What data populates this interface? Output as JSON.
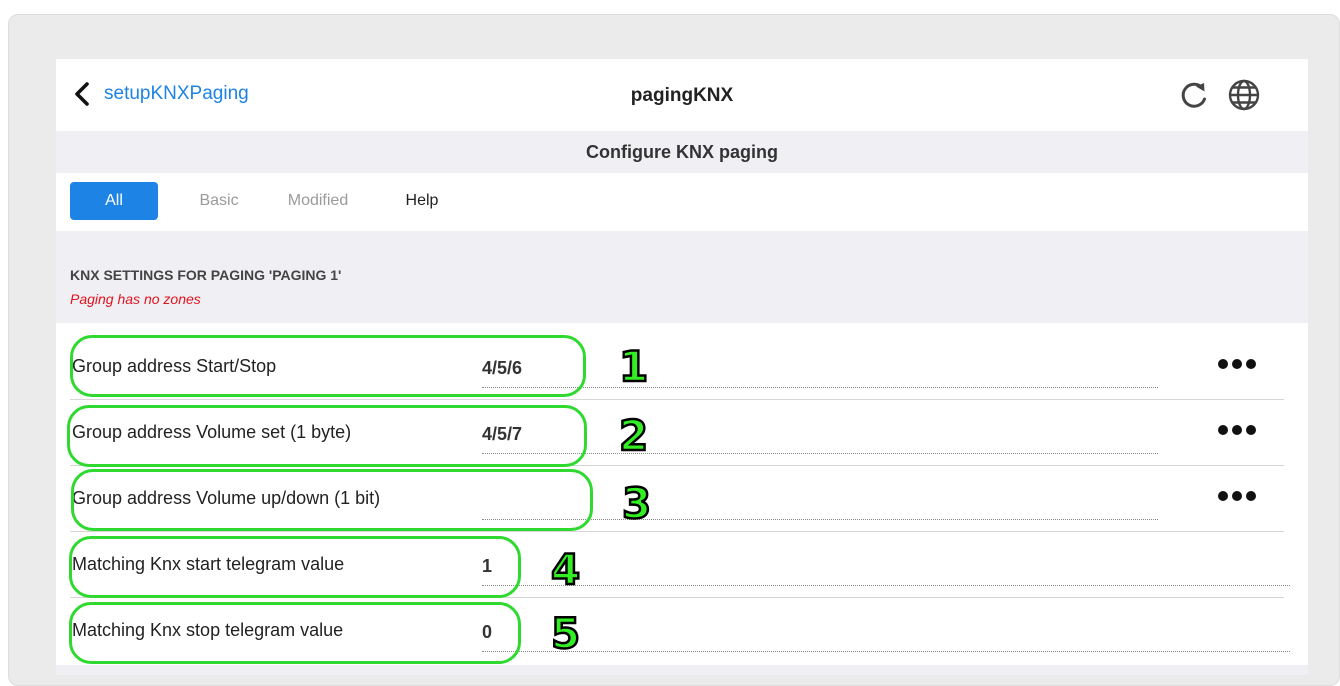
{
  "header": {
    "back_label": "setupKNXPaging",
    "title": "pagingKNX"
  },
  "section_title": "Configure KNX paging",
  "tabs": [
    {
      "label": "All",
      "active": true
    },
    {
      "label": "Basic",
      "active": false
    },
    {
      "label": "Modified",
      "active": false
    },
    {
      "label": "Help",
      "active": false
    }
  ],
  "group": {
    "title": "KNX SETTINGS FOR PAGING 'PAGING 1'",
    "subtitle": "Paging has no zones"
  },
  "rows": [
    {
      "label": "Group address Start/Stop",
      "value": "4/5/6",
      "annotation": "1",
      "has_more": true
    },
    {
      "label": "Group address Volume set (1 byte)",
      "value": "4/5/7",
      "annotation": "2",
      "has_more": true
    },
    {
      "label": "Group address Volume up/down (1 bit)",
      "value": "",
      "annotation": "3",
      "has_more": true
    },
    {
      "label": "Matching Knx start telegram value",
      "value": "1",
      "annotation": "4",
      "has_more": false
    },
    {
      "label": "Matching Knx stop telegram value",
      "value": "0",
      "annotation": "5",
      "has_more": false
    }
  ],
  "colors": {
    "accent": "#1d84e6",
    "warning_text": "#e0141e",
    "annotation_green": "#2fd92f"
  },
  "icons": [
    "chevron-left-icon",
    "refresh-icon",
    "globe-icon",
    "more-icon"
  ]
}
